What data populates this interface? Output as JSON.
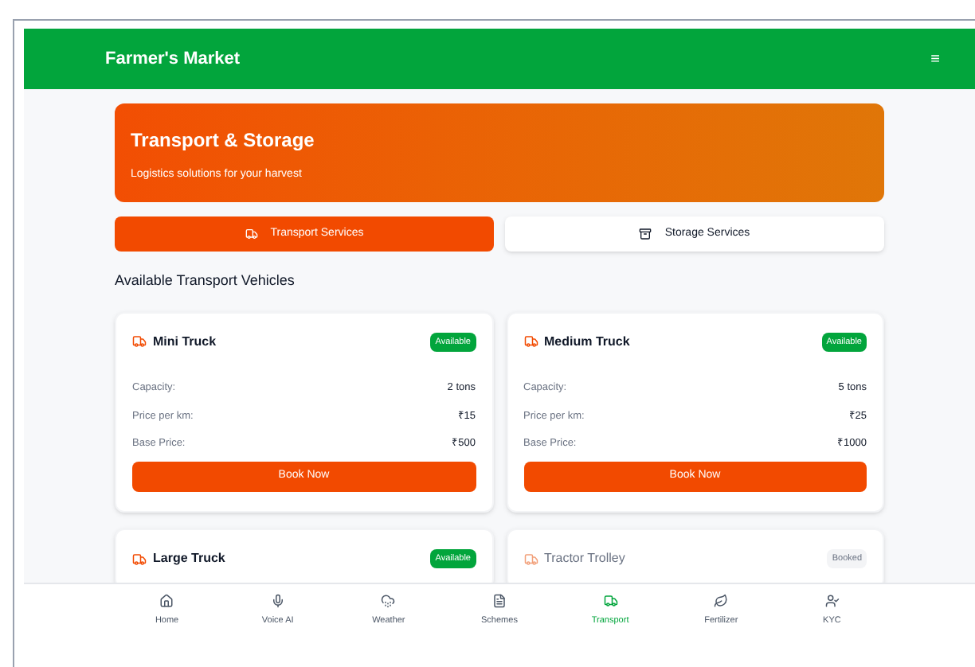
{
  "header": {
    "title": "Farmer's Market",
    "menu_glyph": "≡"
  },
  "hero": {
    "title": "Transport & Storage",
    "subtitle": "Logistics solutions for your harvest"
  },
  "tabs": [
    {
      "label": "Transport Services",
      "selected": true
    },
    {
      "label": "Storage Services",
      "selected": false
    }
  ],
  "section_title": "Available Transport Vehicles",
  "vehicles": [
    {
      "name": "Mini Truck",
      "status": "Available",
      "available": true,
      "details": [
        {
          "label": "Capacity:",
          "value": "2 tons"
        },
        {
          "label": "Price per km:",
          "value": "₹15"
        },
        {
          "label": "Base Price:",
          "value": "₹500"
        }
      ],
      "action": "Book Now"
    },
    {
      "name": "Medium Truck",
      "status": "Available",
      "available": true,
      "details": [
        {
          "label": "Capacity:",
          "value": "5 tons"
        },
        {
          "label": "Price per km:",
          "value": "₹25"
        },
        {
          "label": "Base Price:",
          "value": "₹1000"
        }
      ],
      "action": "Book Now"
    },
    {
      "name": "Large Truck",
      "status": "Available",
      "available": true
    },
    {
      "name": "Tractor Trolley",
      "status": "Booked",
      "available": false
    }
  ],
  "nav": [
    {
      "label": "Home",
      "selected": false
    },
    {
      "label": "Voice AI",
      "selected": false
    },
    {
      "label": "Weather",
      "selected": false
    },
    {
      "label": "Schemes",
      "selected": false
    },
    {
      "label": "Transport",
      "selected": true
    },
    {
      "label": "Fertilizer",
      "selected": false
    },
    {
      "label": "KYC",
      "selected": false
    }
  ]
}
